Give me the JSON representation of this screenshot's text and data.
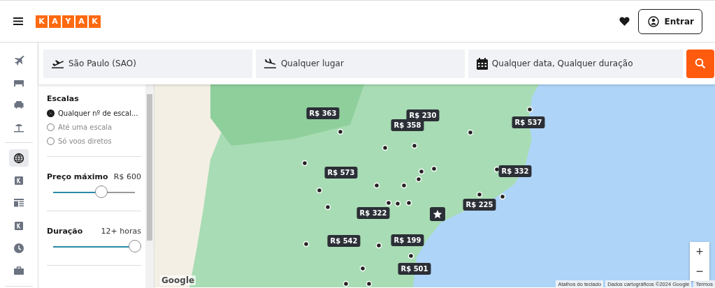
{
  "header": {
    "logo": [
      "K",
      "A",
      "Y",
      "A",
      "K"
    ],
    "login_button": "Entrar"
  },
  "rail": [
    {
      "kind": "plane",
      "selected": false
    },
    {
      "kind": "bed",
      "selected": false
    },
    {
      "kind": "car",
      "selected": false
    },
    {
      "kind": "beach",
      "selected": false
    },
    {
      "kind": "divider"
    },
    {
      "kind": "globe",
      "selected": true
    },
    {
      "kind": "k",
      "selected": false
    },
    {
      "kind": "news",
      "selected": false
    },
    {
      "kind": "k",
      "selected": false
    },
    {
      "kind": "clock",
      "selected": false
    },
    {
      "kind": "briefcase",
      "selected": false
    },
    {
      "kind": "divider"
    }
  ],
  "search": {
    "origin": "São Paulo (SAO)",
    "destination": "Qualquer lugar",
    "dates": "Qualquer data, Qualquer duração"
  },
  "filters": {
    "stops": {
      "title": "Escalas",
      "options": [
        {
          "label": "Qualquer nº de escal...",
          "selected": true
        },
        {
          "label": "Até uma escala",
          "selected": false
        },
        {
          "label": "Só voos diretos",
          "selected": false
        }
      ]
    },
    "price": {
      "title": "Preço máximo",
      "reading": "R$ 600",
      "level": 0.59
    },
    "duration": {
      "title": "Duração",
      "reading": "12+ horas",
      "level": 1
    }
  },
  "map": {
    "markers": [
      {
        "price": "R$ 363"
      },
      {
        "price": "R$ 230"
      },
      {
        "price": "R$ 358"
      },
      {
        "price": "R$ 537"
      },
      {
        "price": "R$ 573"
      },
      {
        "price": "R$ 332"
      },
      {
        "price": "R$ 322"
      },
      {
        "price": "R$ 225"
      },
      {
        "price": "R$ 542"
      },
      {
        "price": "R$ 199"
      },
      {
        "price": "R$ 501"
      }
    ],
    "zoom_in": "+",
    "zoom_out": "−",
    "logo": "Google",
    "attribution": [
      "Atalhos do teclado",
      "Dados cartográficos ©2024 Google",
      "Termos"
    ]
  }
}
